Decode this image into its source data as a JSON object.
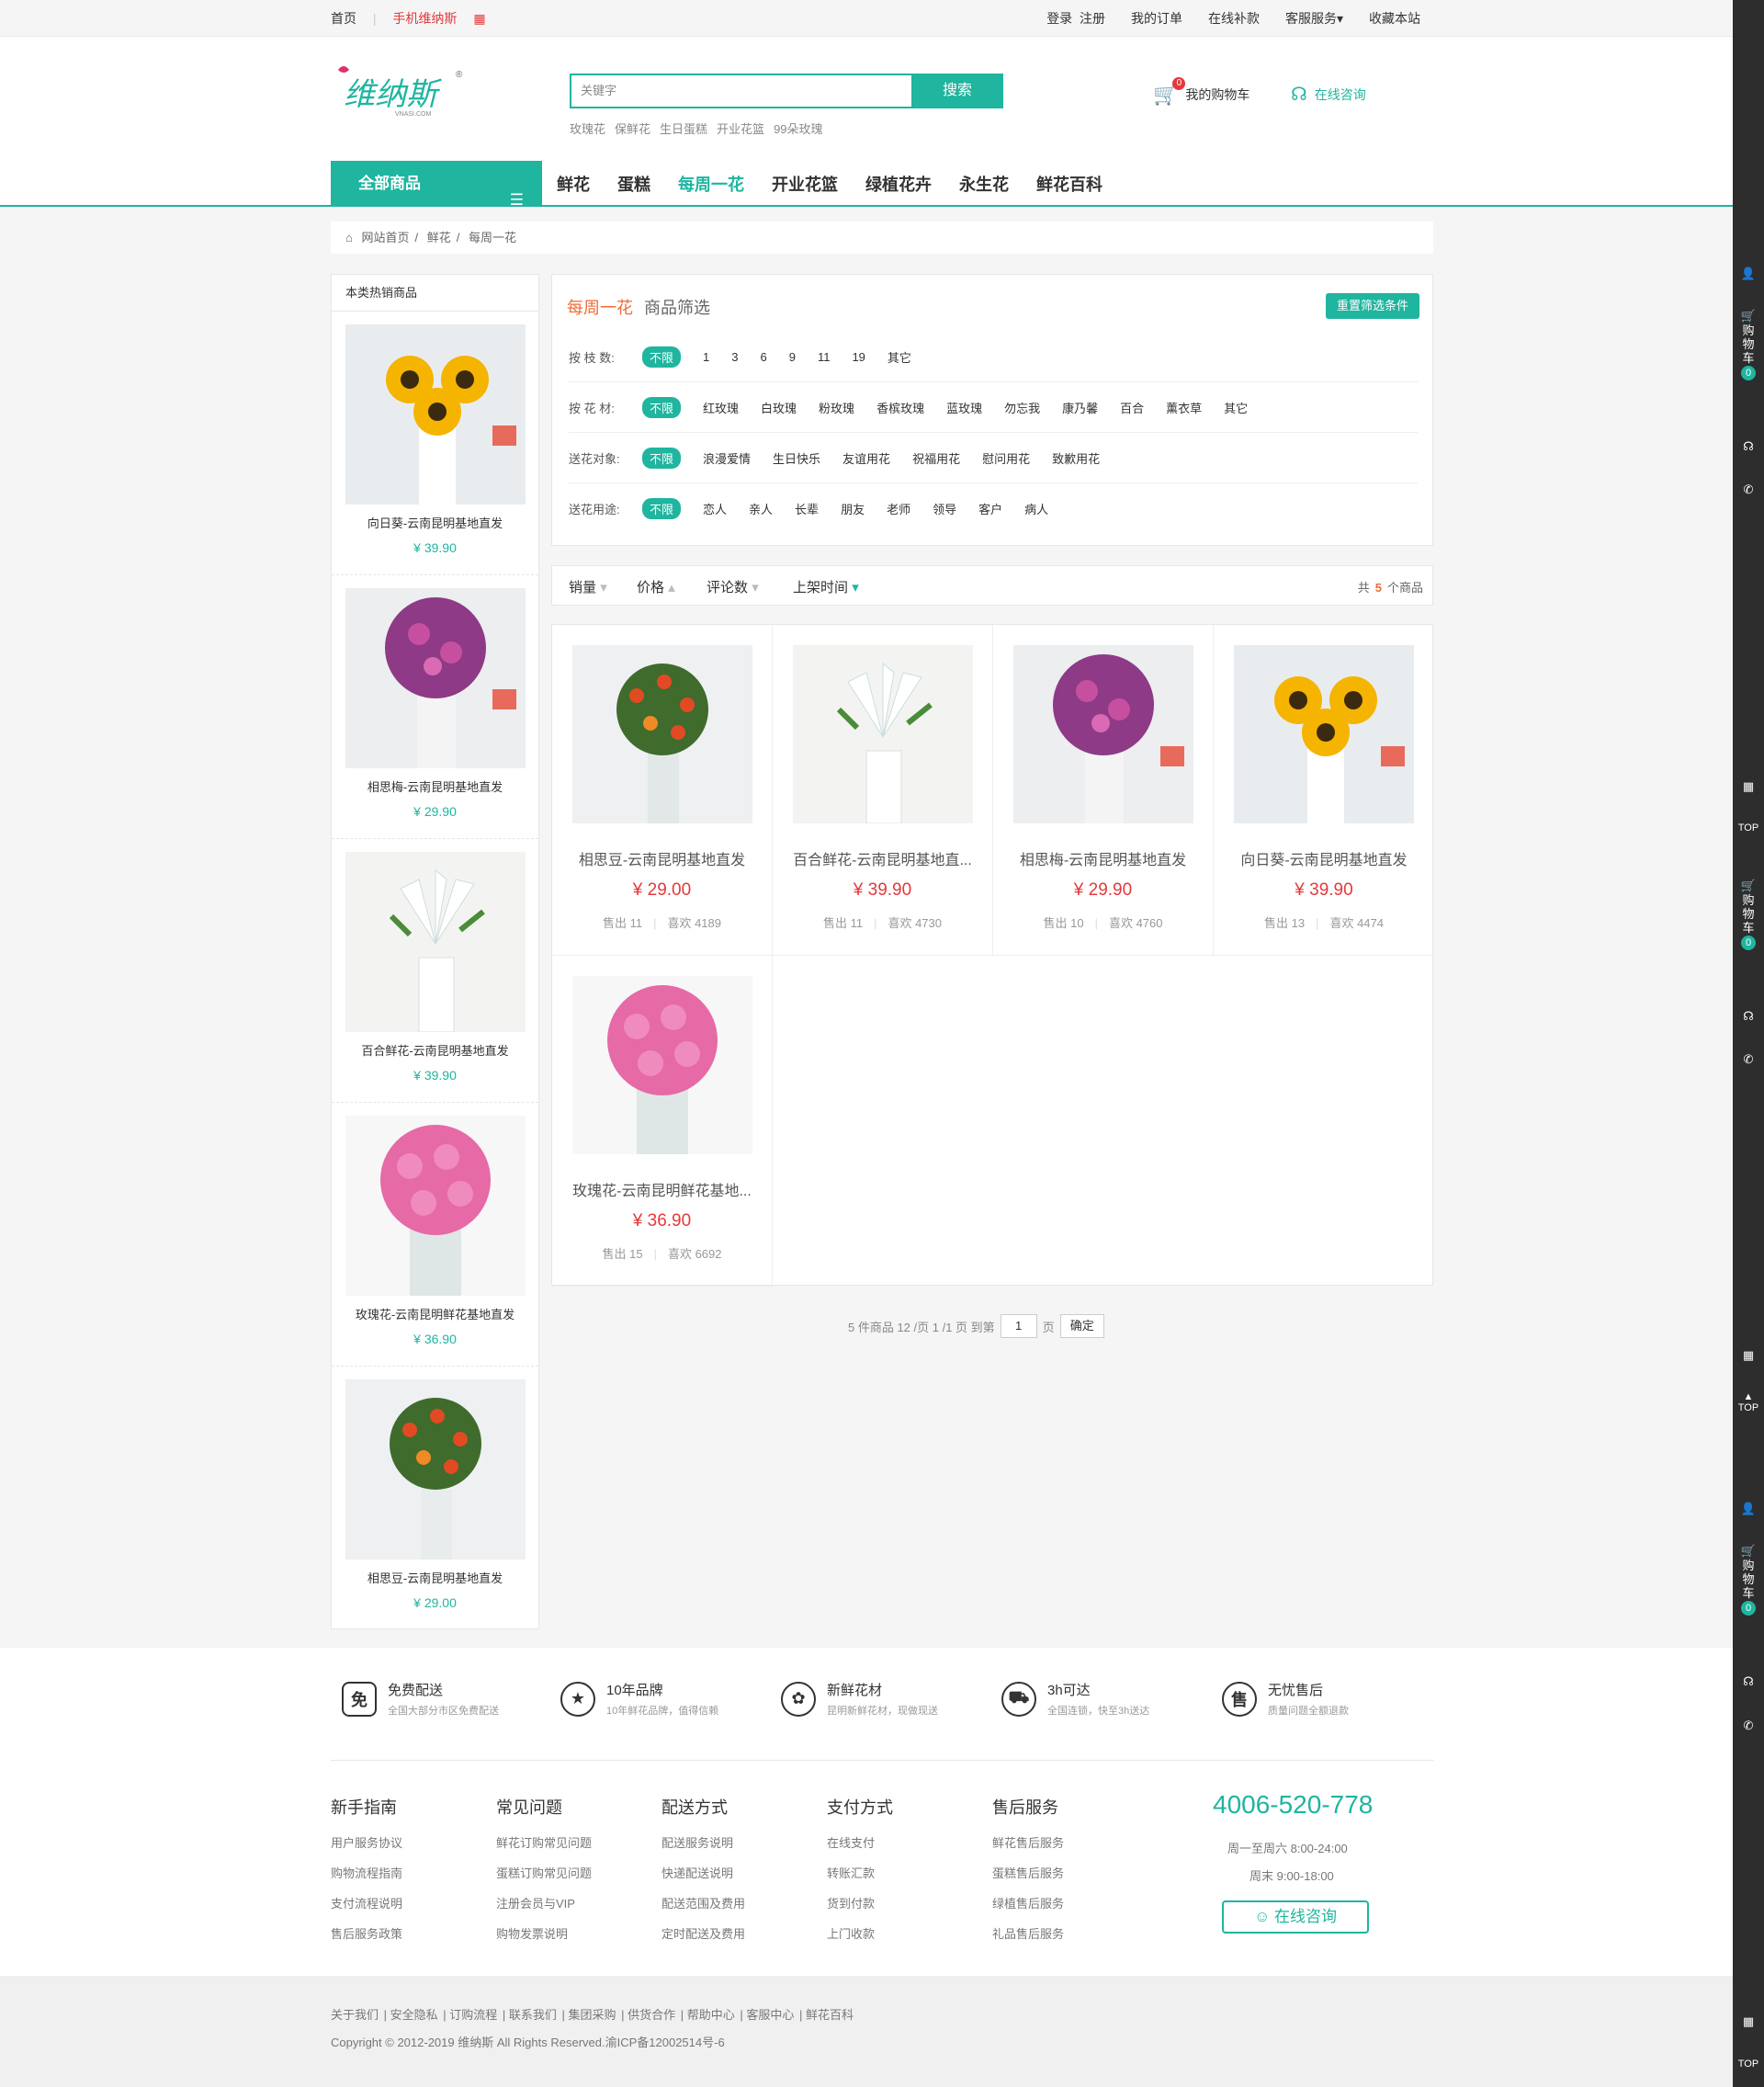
{
  "topbar": {
    "home": "首页",
    "mobile": "手机维纳斯",
    "login": "登录",
    "register": "注册",
    "orders": "我的订单",
    "pay": "在线补款",
    "service": "客服服务",
    "fav": "收藏本站"
  },
  "header": {
    "logo_text": "维纳斯",
    "logo_sub": "VNASI.COM",
    "search_placeholder": "关键字",
    "search_btn": "搜索",
    "hot": [
      "玫瑰花",
      "保鲜花",
      "生日蛋糕",
      "开业花篮",
      "99朵玫瑰"
    ],
    "cart_count": "0",
    "cart_label": "我的购物车",
    "consult_label": "在线咨询"
  },
  "nav": {
    "all": "全部商品",
    "items": [
      "鲜花",
      "蛋糕",
      "每周一花",
      "开业花篮",
      "绿植花卉",
      "永生花",
      "鲜花百科"
    ]
  },
  "crumb": [
    "网站首页",
    "鲜花",
    "每周一花"
  ],
  "side": {
    "title": "本类热销商品",
    "items": [
      {
        "name": "向日葵-云南昆明基地直发",
        "price": "¥ 39.90"
      },
      {
        "name": "相思梅-云南昆明基地直发",
        "price": "¥ 29.90"
      },
      {
        "name": "百合鲜花-云南昆明基地直发",
        "price": "¥ 39.90"
      },
      {
        "name": "玫瑰花-云南昆明鲜花基地直发",
        "price": "¥ 36.90"
      },
      {
        "name": "相思豆-云南昆明基地直发",
        "price": "¥ 29.00"
      }
    ]
  },
  "filter": {
    "title": "每周一花",
    "subtitle": "商品筛选",
    "reset": "重置筛选条件",
    "rows": [
      {
        "label": "按 枝 数:",
        "sel": "不限",
        "opts": [
          "1",
          "3",
          "6",
          "9",
          "11",
          "19",
          "其它"
        ]
      },
      {
        "label": "按 花 材:",
        "sel": "不限",
        "opts": [
          "红玫瑰",
          "白玫瑰",
          "粉玫瑰",
          "香槟玫瑰",
          "蓝玫瑰",
          "勿忘我",
          "康乃馨",
          "百合",
          "薰衣草",
          "其它"
        ]
      },
      {
        "label": "送花对象:",
        "sel": "不限",
        "opts": [
          "浪漫爱情",
          "生日快乐",
          "友谊用花",
          "祝福用花",
          "慰问用花",
          "致歉用花"
        ]
      },
      {
        "label": "送花用途:",
        "sel": "不限",
        "opts": [
          "恋人",
          "亲人",
          "长辈",
          "朋友",
          "老师",
          "领导",
          "客户",
          "病人"
        ]
      }
    ]
  },
  "sort": {
    "sales": "销量",
    "price": "价格",
    "reviews": "评论数",
    "time": "上架时间",
    "total_pre": "共",
    "total": "5",
    "total_post": "个商品"
  },
  "products": [
    {
      "name": "相思豆-云南昆明基地直发",
      "price": "¥ 29.00",
      "sold": "售出 11",
      "likes": "喜欢 4189"
    },
    {
      "name": "百合鲜花-云南昆明基地直...",
      "price": "¥ 39.90",
      "sold": "售出 11",
      "likes": "喜欢 4730"
    },
    {
      "name": "相思梅-云南昆明基地直发",
      "price": "¥ 29.90",
      "sold": "售出 10",
      "likes": "喜欢 4760"
    },
    {
      "name": "向日葵-云南昆明基地直发",
      "price": "¥ 39.90",
      "sold": "售出 13",
      "likes": "喜欢 4474"
    },
    {
      "name": "玫瑰花-云南昆明鲜花基地...",
      "price": "¥ 36.90",
      "sold": "售出 15",
      "likes": "喜欢 6692"
    }
  ],
  "pager": {
    "info": "5 件商品 12 /页 1 /1 页 到第",
    "page": "1",
    "unit": "页",
    "ok": "确定"
  },
  "features": [
    {
      "icon": "免",
      "t1": "免费配送",
      "t2": "全国大部分市区免费配送"
    },
    {
      "icon": "★",
      "t1": "10年品牌",
      "t2": "10年鲜花品牌，值得信赖"
    },
    {
      "icon": "✿",
      "t1": "新鲜花材",
      "t2": "昆明新鲜花材，现做现送"
    },
    {
      "icon": "⛟",
      "t1": "3h可达",
      "t2": "全国连锁，快至3h送达"
    },
    {
      "icon": "售",
      "t1": "无忧售后",
      "t2": "质量问题全额退款"
    }
  ],
  "footer_cols": [
    {
      "h": "新手指南",
      "links": [
        "用户服务协议",
        "购物流程指南",
        "支付流程说明",
        "售后服务政策"
      ]
    },
    {
      "h": "常见问题",
      "links": [
        "鲜花订购常见问题",
        "蛋糕订购常见问题",
        "注册会员与VIP",
        "购物发票说明"
      ]
    },
    {
      "h": "配送方式",
      "links": [
        "配送服务说明",
        "快递配送说明",
        "配送范围及费用",
        "定时配送及费用"
      ]
    },
    {
      "h": "支付方式",
      "links": [
        "在线支付",
        "转账汇款",
        "货到付款",
        "上门收款"
      ]
    },
    {
      "h": "售后服务",
      "links": [
        "鲜花售后服务",
        "蛋糕售后服务",
        "绿植售后服务",
        "礼品售后服务"
      ]
    }
  ],
  "contact": {
    "tel": "4006-520-778",
    "h1": "周一至周六 8:00-24:00",
    "h2": "周末 9:00-18:00",
    "btn": "在线咨询"
  },
  "bottom": {
    "links": [
      "关于我们",
      "安全隐私",
      "订购流程",
      "联系我们",
      "集团采购",
      "供货合作",
      "帮助中心",
      "客服中心",
      "鲜花百科"
    ],
    "copy": "Copyright © 2012-2019 维纳斯 All Rights Reserved.渝ICP备12002514号-6"
  },
  "rbar": {
    "cart": "购物车",
    "zero": "0",
    "top": "TOP"
  },
  "colors": {
    "accent": "#1fb59f",
    "price": "#e4393c",
    "orange": "#f06b35"
  }
}
